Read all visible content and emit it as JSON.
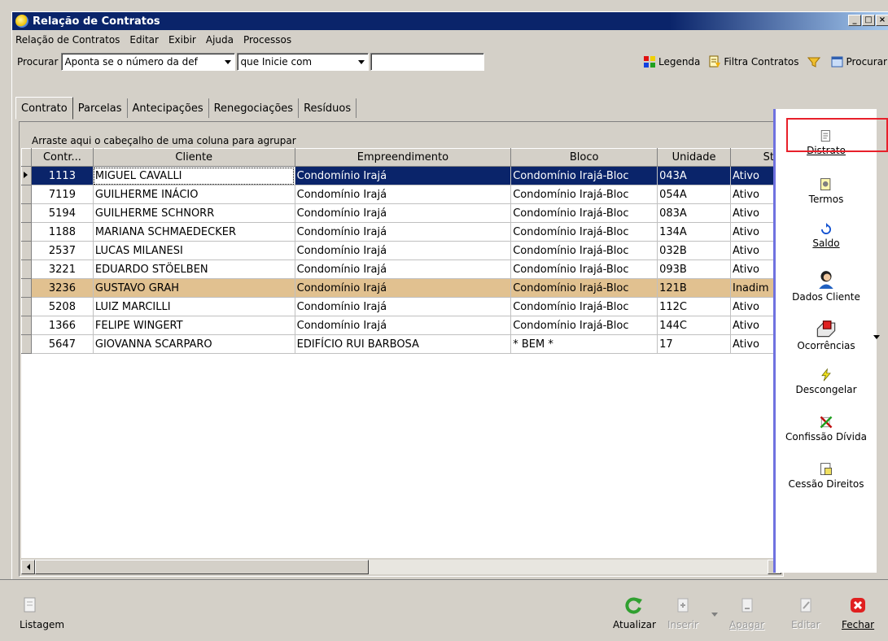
{
  "window": {
    "title": "Relação de Contratos"
  },
  "menu": [
    "Relação de Contratos",
    "Editar",
    "Exibir",
    "Ajuda",
    "Processos"
  ],
  "search": {
    "label": "Procurar",
    "field_value": "Aponta se o número da def",
    "mode_value": "que Inicie com",
    "text_value": ""
  },
  "toolbar": {
    "legend_label": "Legenda",
    "filter_label": "Filtra Contratos",
    "search_label": "Procurar"
  },
  "tabs": [
    "Contrato",
    "Parcelas",
    "Antecipações",
    "Renegociações",
    "Resíduos"
  ],
  "grid": {
    "group_hint": "Arraste aqui o cabeçalho de uma coluna para agrupar",
    "columns": [
      "Contr...",
      "Cliente",
      "Empreendimento",
      "Bloco",
      "Unidade",
      "Sta"
    ],
    "rows": [
      {
        "contrato": "1113",
        "cliente": "MIGUEL CAVALLI",
        "empreendimento": "Condomínio Irajá",
        "bloco": "Condomínio Irajá-Bloc",
        "unidade": "043A",
        "status": "Ativo"
      },
      {
        "contrato": "7119",
        "cliente": "GUILHERME INÁCIO",
        "empreendimento": "Condomínio Irajá",
        "bloco": "Condomínio Irajá-Bloc",
        "unidade": "054A",
        "status": "Ativo"
      },
      {
        "contrato": "5194",
        "cliente": "GUILHERME SCHNORR",
        "empreendimento": "Condomínio Irajá",
        "bloco": "Condomínio Irajá-Bloc",
        "unidade": "083A",
        "status": "Ativo"
      },
      {
        "contrato": "1188",
        "cliente": "MARIANA SCHMAEDECKER",
        "empreendimento": "Condomínio Irajá",
        "bloco": "Condomínio Irajá-Bloc",
        "unidade": "134A",
        "status": "Ativo"
      },
      {
        "contrato": "2537",
        "cliente": "LUCAS MILANESI",
        "empreendimento": "Condomínio Irajá",
        "bloco": "Condomínio Irajá-Bloc",
        "unidade": "032B",
        "status": "Ativo"
      },
      {
        "contrato": "3221",
        "cliente": "EDUARDO STÖELBEN",
        "empreendimento": "Condomínio Irajá",
        "bloco": "Condomínio Irajá-Bloc",
        "unidade": "093B",
        "status": "Ativo"
      },
      {
        "contrato": "3236",
        "cliente": "GUSTAVO GRAH",
        "empreendimento": "Condomínio Irajá",
        "bloco": "Condomínio Irajá-Bloc",
        "unidade": "121B",
        "status": "Inadim"
      },
      {
        "contrato": "5208",
        "cliente": "LUIZ MARCILLI",
        "empreendimento": "Condomínio Irajá",
        "bloco": "Condomínio Irajá-Bloc",
        "unidade": "112C",
        "status": "Ativo"
      },
      {
        "contrato": "1366",
        "cliente": "FELIPE WINGERT",
        "empreendimento": "Condomínio Irajá",
        "bloco": "Condomínio Irajá-Bloc",
        "unidade": "144C",
        "status": "Ativo"
      },
      {
        "contrato": "5647",
        "cliente": "GIOVANNA SCARPARO",
        "empreendimento": "EDIFÍCIO RUI BARBOSA",
        "bloco": " * BEM *",
        "unidade": "17",
        "status": "Ativo"
      }
    ]
  },
  "side": {
    "distrato": "Distrato",
    "termos": "Termos",
    "saldo": "Saldo",
    "dados_cliente": "Dados Cliente",
    "ocorrencias": "Ocorrências",
    "descongelar": "Descongelar",
    "confissao": "Confissão Dívida",
    "cessao": "Cessão Direitos"
  },
  "bottom": {
    "listagem": "Listagem",
    "atualizar": "Atualizar",
    "inserir": "Inserir",
    "apagar": "Apagar",
    "editar": "Editar",
    "fechar": "Fechar"
  },
  "colors": {
    "titlebar": "#0a246a",
    "selected_row": "#0a246a",
    "inadimplente_row": "#e1c190",
    "highlight": "#e8202a"
  }
}
